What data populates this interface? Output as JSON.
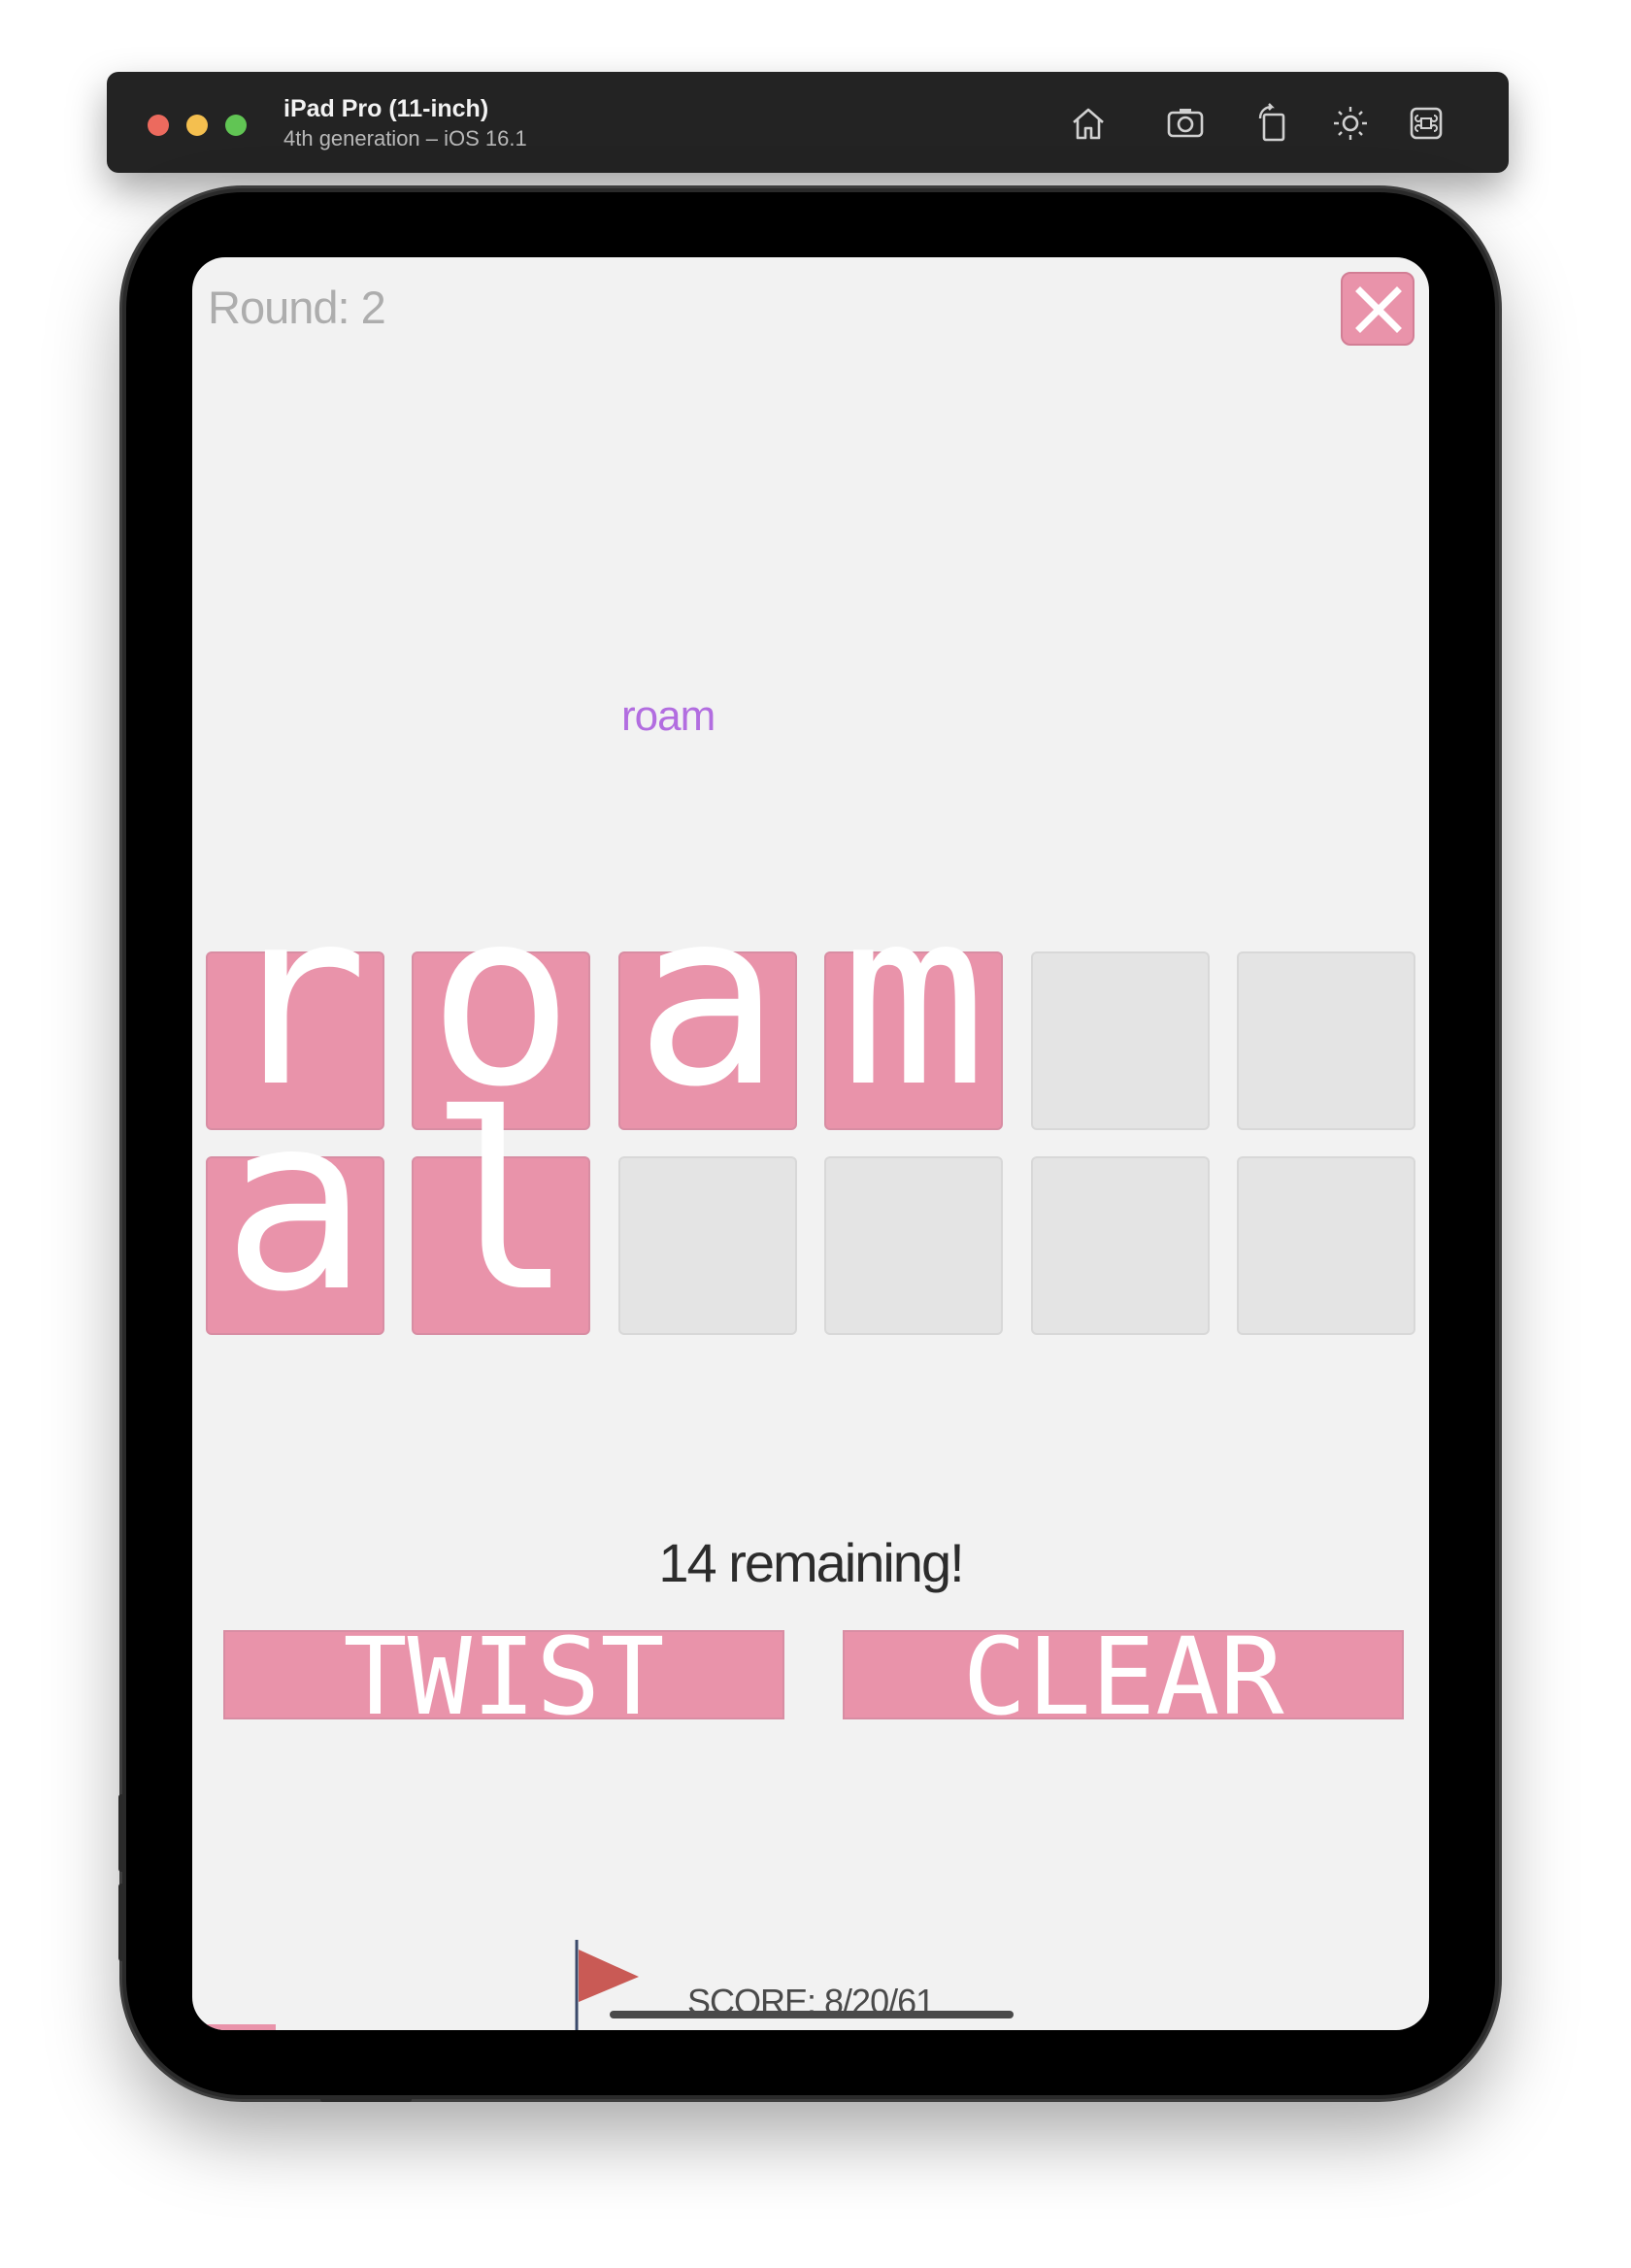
{
  "simulator": {
    "device_name": "iPad Pro (11-inch)",
    "device_detail": "4th generation – iOS 16.1",
    "toolbar_icons": [
      "home-icon",
      "screenshot-icon",
      "rotate-icon",
      "appearance-icon",
      "command-icon"
    ]
  },
  "game": {
    "round_label": "Round: 2",
    "close_icon": "close-icon",
    "found_word": "roam",
    "tiles_row1": [
      "r",
      "o",
      "a",
      "m",
      "",
      ""
    ],
    "tiles_row2": [
      "a",
      "l",
      "",
      "",
      "",
      ""
    ],
    "remaining_text": "14 remaining!",
    "twist_label": "TWIST",
    "clear_label": "CLEAR",
    "score_text": "SCORE: 8/20/61",
    "flag_icon": "flag-icon"
  },
  "colors": {
    "tile_filled": "#e993aa",
    "tile_empty": "#e4e4e4",
    "found_word": "#b26de0",
    "background": "#f2f2f2",
    "flag": "#c95a55"
  }
}
